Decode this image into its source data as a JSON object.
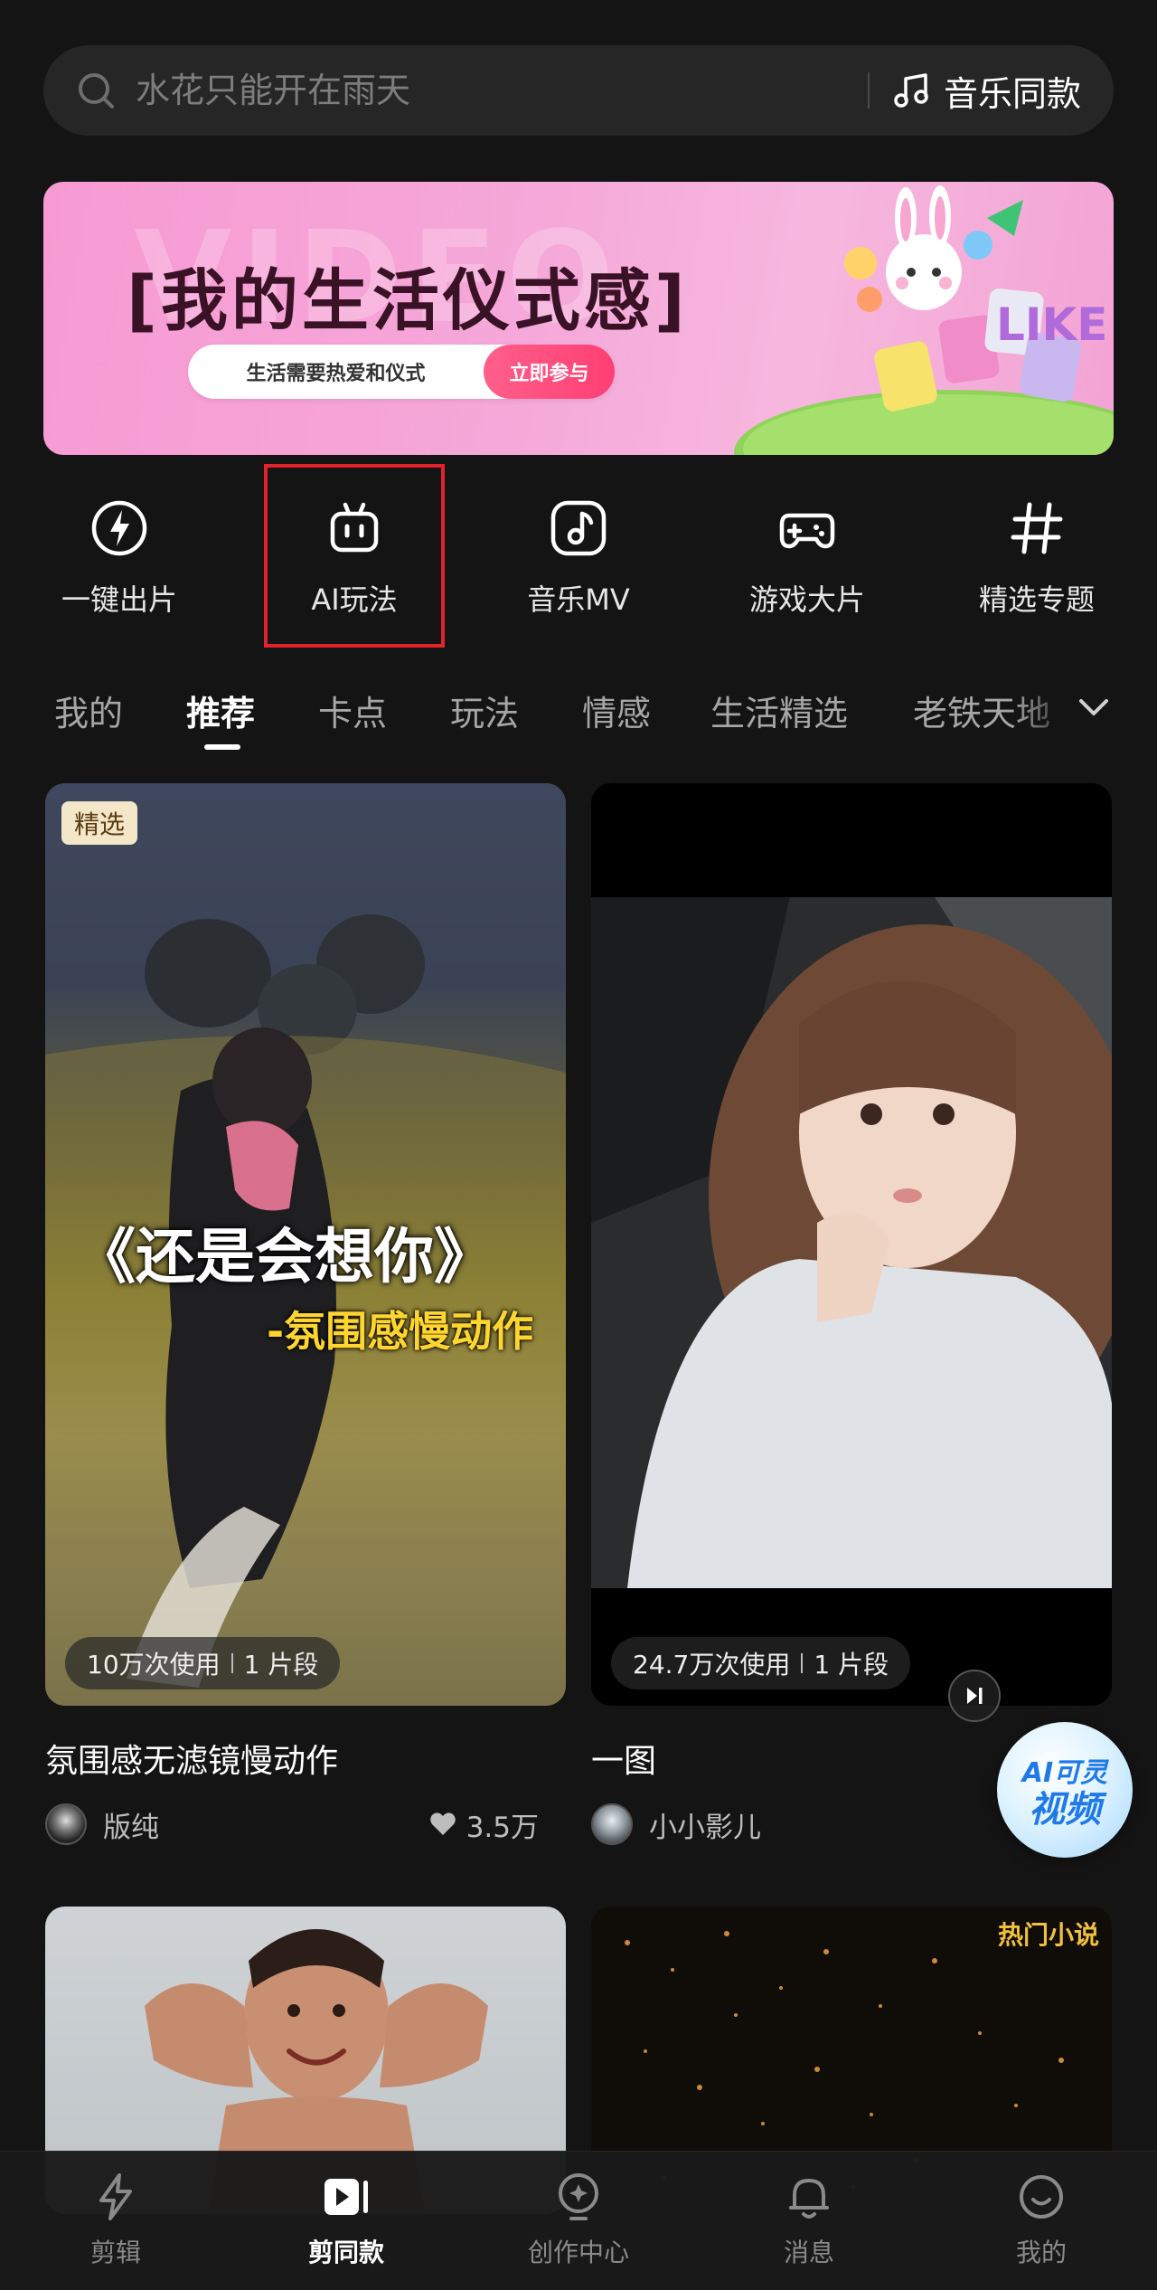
{
  "search": {
    "placeholder": "水花只能开在雨天",
    "music_same_label": "音乐同款"
  },
  "banner": {
    "ghost_text": "VIDEO",
    "title": "[我的生活仪式感]",
    "subtitle": "生活需要热爱和仪式",
    "cta_label": "立即参与",
    "art_letters": "LIKE"
  },
  "quick_entries": [
    {
      "label": "一键出片",
      "icon": "lightning-icon"
    },
    {
      "label": "AI玩法",
      "icon": "robot-icon"
    },
    {
      "label": "音乐MV",
      "icon": "music-note-icon"
    },
    {
      "label": "游戏大片",
      "icon": "gamepad-icon"
    },
    {
      "label": "精选专题",
      "icon": "hash-icon"
    }
  ],
  "tabs": [
    "我的",
    "推荐",
    "卡点",
    "玩法",
    "情感",
    "生活精选",
    "老铁天地"
  ],
  "active_tab": "推荐",
  "cards": [
    {
      "badge": "精选",
      "overlay_title": "《还是会想你》",
      "overlay_subtitle": "-氛围感慢动作",
      "usage": "10万次使用",
      "segments": "1 片段",
      "title": "氛围感无滤镜慢动作",
      "author": "版纯",
      "likes": "3.5万"
    },
    {
      "usage": "24.7万次使用",
      "segments": "1 片段",
      "title": "一图",
      "author": "小小影儿",
      "likes": ""
    },
    {
      "tag": ""
    },
    {
      "tag": "热门小说"
    }
  ],
  "ai_float": {
    "line1": "AI可灵",
    "line2": "视频"
  },
  "bottom_nav": [
    {
      "label": "剪辑",
      "icon": "lightning-icon"
    },
    {
      "label": "剪同款",
      "icon": "template-icon"
    },
    {
      "label": "创作中心",
      "icon": "bulb-icon"
    },
    {
      "label": "消息",
      "icon": "bell-icon"
    },
    {
      "label": "我的",
      "icon": "smile-icon"
    }
  ],
  "colors": {
    "background": "#141414",
    "highlight_box": "#e2232c",
    "accent_blue": "#1f7ae8"
  }
}
